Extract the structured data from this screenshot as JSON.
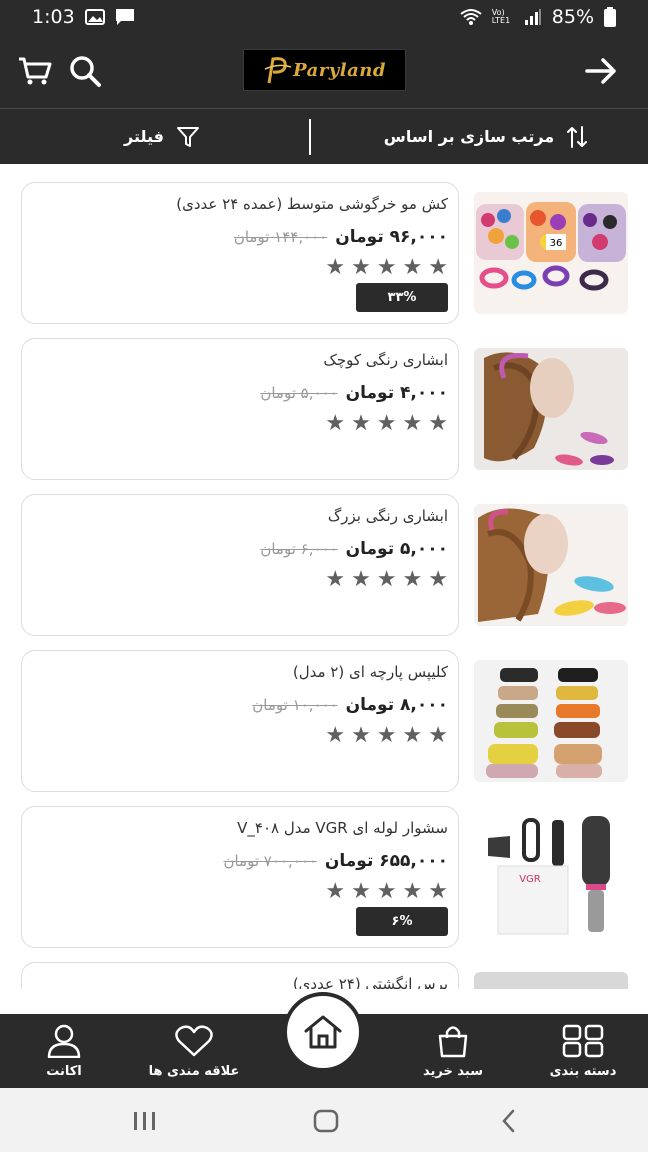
{
  "status": {
    "time": "1:03",
    "battery": "85%",
    "network": "Vo) LTE1"
  },
  "header": {
    "logo_text": "Paryland"
  },
  "sortbar": {
    "sort_label": "مرتب سازی بر اساس",
    "filter_label": "فیلتر"
  },
  "products": [
    {
      "title": "کش مو خرگوشی متوسط (عمده ۲۴ عددی)",
      "old_price": "۱۴۴,۰۰۰ تومان",
      "new_price": "۹۶,۰۰۰ تومان",
      "rating": 5,
      "discount": "۳۳%",
      "image": "colorful-hair-ties-bags"
    },
    {
      "title": "ابشاری رنگی کوچک",
      "old_price": "۵,۰۰۰ تومان",
      "new_price": "۴,۰۰۰ تومان",
      "rating": 5,
      "discount": "",
      "image": "small-hair-claw-on-mannequin"
    },
    {
      "title": "ابشاری رنگی بزرگ",
      "old_price": "۶,۰۰۰ تومان",
      "new_price": "۵,۰۰۰ تومان",
      "rating": 5,
      "discount": "",
      "image": "large-hair-claw-on-mannequin"
    },
    {
      "title": "کلیپس پارچه ای (۲ مدل)",
      "old_price": "۱۰,۰۰۰ تومان",
      "new_price": "۸,۰۰۰ تومان",
      "rating": 5,
      "discount": "",
      "image": "fabric-hair-clips-grid"
    },
    {
      "title": "سشوار لوله ای VGR مدل V_۴۰۸",
      "old_price": "۷۰۰,۰۰۰ تومان",
      "new_price": "۶۵۵,۰۰۰ تومان",
      "rating": 5,
      "discount": "۶%",
      "image": "vgr-hot-air-brush-set"
    },
    {
      "title": "برس انگشتی (۲۴ عددی)",
      "old_price": "",
      "new_price": "",
      "rating": 5,
      "discount": "",
      "image": "finger-brush"
    }
  ],
  "bottomnav": {
    "categories": "دسته بندی",
    "cart": "سبد خرید",
    "home": "",
    "favorites": "علاقه مندی ها",
    "account": "اکانت"
  },
  "colors": {
    "dark": "#2b2b2b",
    "gold": "#d9a93a",
    "star": "#606060"
  }
}
